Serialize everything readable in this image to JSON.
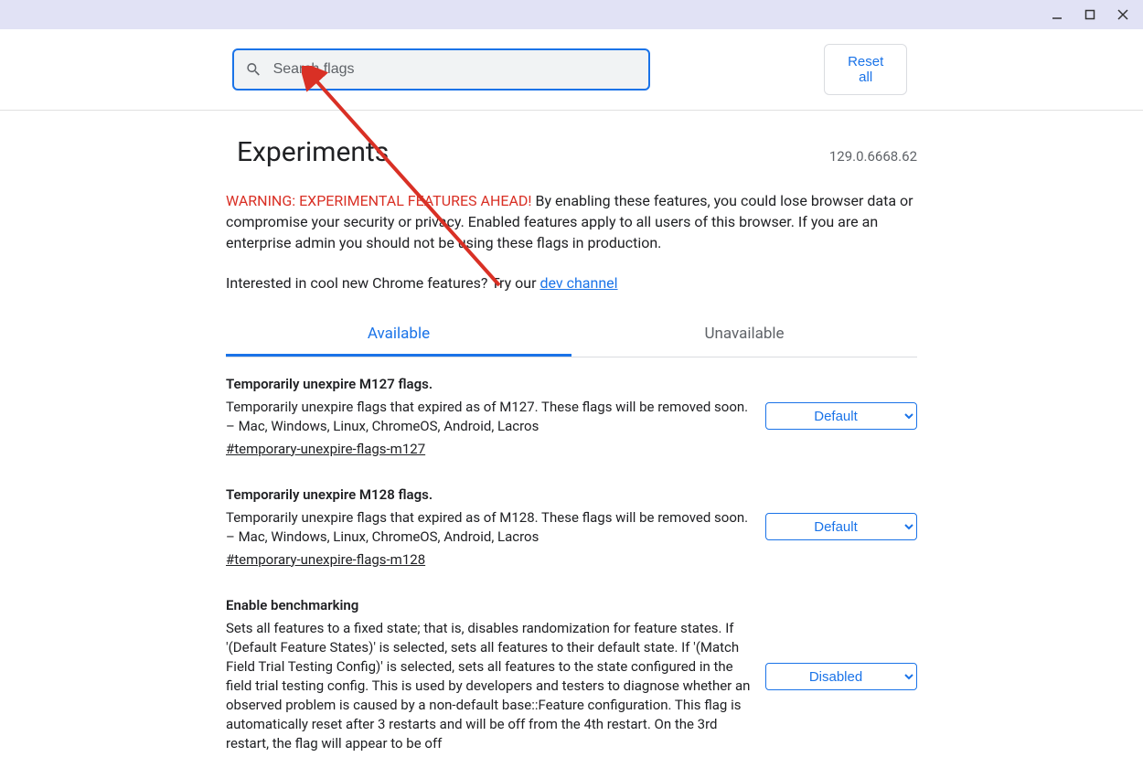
{
  "window": {
    "minimize": "minimize",
    "maximize": "maximize",
    "close": "close"
  },
  "search": {
    "placeholder": "Search flags"
  },
  "reset_label": "Reset all",
  "page_title": "Experiments",
  "version": "129.0.6668.62",
  "warning_prefix": "WARNING: EXPERIMENTAL FEATURES AHEAD!",
  "warning_body": " By enabling these features, you could lose browser data or compromise your security or privacy. Enabled features apply to all users of this browser. If you are an enterprise admin you should not be using these flags in production.",
  "interested_prefix": "Interested in cool new Chrome features? Try our ",
  "dev_channel_label": "dev channel",
  "tabs": {
    "available": "Available",
    "unavailable": "Unavailable"
  },
  "flags": [
    {
      "title": "Temporarily unexpire M127 flags.",
      "description": "Temporarily unexpire flags that expired as of M127. These flags will be removed soon. – Mac, Windows, Linux, ChromeOS, Android, Lacros",
      "hash": "#temporary-unexpire-flags-m127",
      "selected": "Default"
    },
    {
      "title": "Temporarily unexpire M128 flags.",
      "description": "Temporarily unexpire flags that expired as of M128. These flags will be removed soon. – Mac, Windows, Linux, ChromeOS, Android, Lacros",
      "hash": "#temporary-unexpire-flags-m128",
      "selected": "Default"
    },
    {
      "title": "Enable benchmarking",
      "description": "Sets all features to a fixed state; that is, disables randomization for feature states. If '(Default Feature States)' is selected, sets all features to their default state. If '(Match Field Trial Testing Config)' is selected, sets all features to the state configured in the field trial testing config. This is used by developers and testers to diagnose whether an observed problem is caused by a non-default base::Feature configuration. This flag is automatically reset after 3 restarts and will be off from the 4th restart. On the 3rd restart, the flag will appear to be off",
      "hash": "",
      "selected": "Disabled"
    }
  ]
}
